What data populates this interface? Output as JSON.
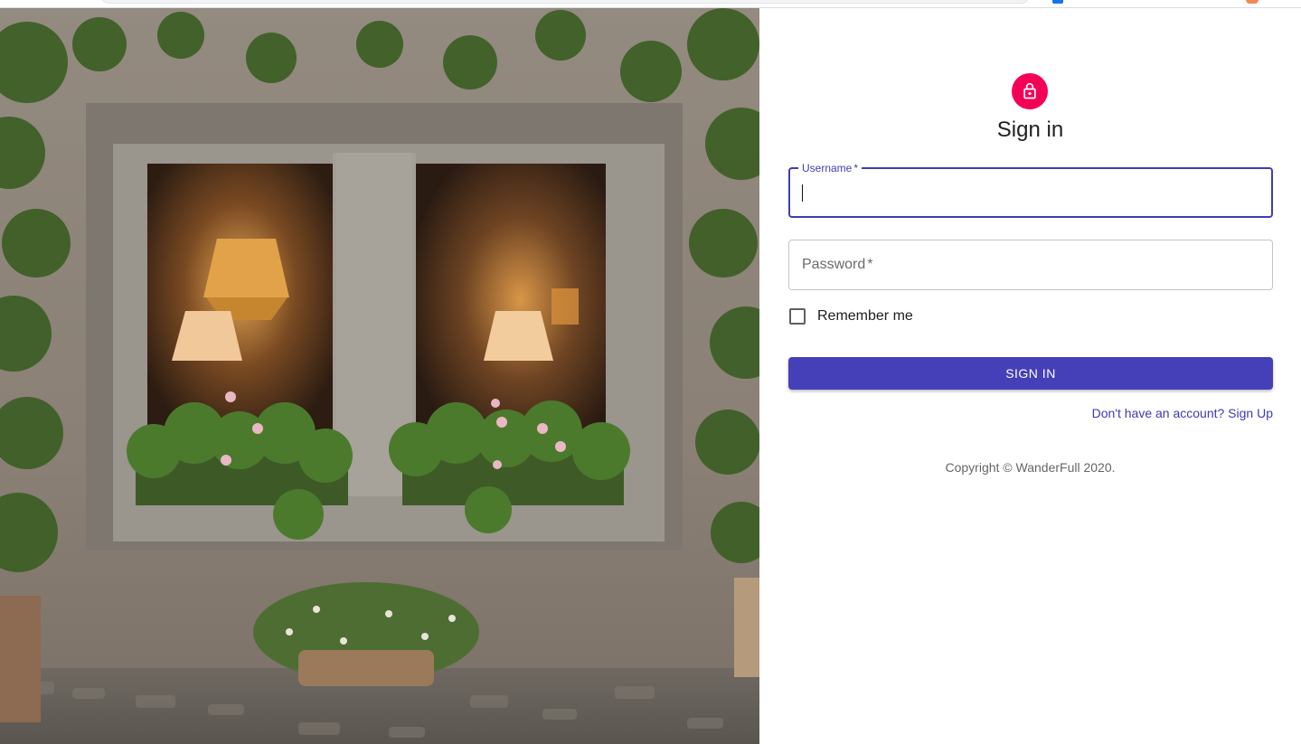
{
  "form": {
    "title": "Sign in",
    "username": {
      "label": "Username",
      "required_mark": "*",
      "value": ""
    },
    "password": {
      "label": "Password",
      "required_mark": "*",
      "value": ""
    },
    "remember_me": {
      "label": "Remember me",
      "checked": false
    },
    "submit_label": "SIGN IN",
    "signup_link": "Don't have an account? Sign Up",
    "copyright": "Copyright © WanderFull 2020."
  },
  "colors": {
    "primary": "#3f3db3",
    "button": "#4540b8",
    "avatar": "#f50057"
  },
  "icons": {
    "avatar": "lock-icon"
  }
}
